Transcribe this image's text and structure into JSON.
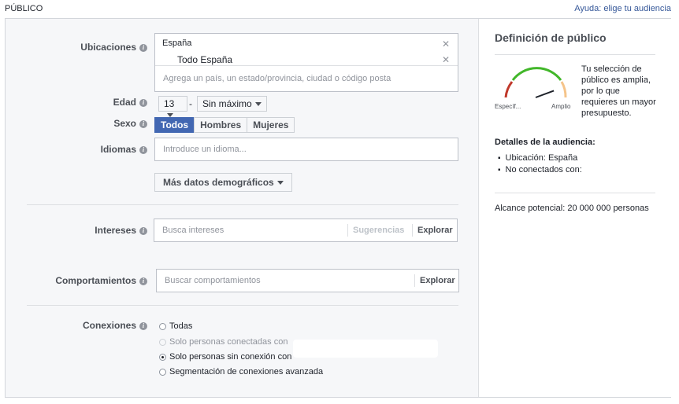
{
  "header": {
    "section_title": "PÚBLICO",
    "help_link": "Ayuda: elige tu audiencia"
  },
  "form": {
    "locations": {
      "label": "Ubicaciones",
      "country": "España",
      "region": "Todo España",
      "remove_icon": "close-icon",
      "input_placeholder": "Agrega un país, un estado/provincia, ciudad o código posta"
    },
    "age": {
      "label": "Edad",
      "min": "13",
      "separator": "-",
      "max": "Sin máximo"
    },
    "gender": {
      "label": "Sexo",
      "options": [
        "Todos",
        "Hombres",
        "Mujeres"
      ],
      "selected": "Todos"
    },
    "languages": {
      "label": "Idiomas",
      "placeholder": "Introduce un idioma..."
    },
    "more_demographics": "Más datos demográficos",
    "interests": {
      "label": "Intereses",
      "placeholder": "Busca intereses",
      "suggestions": "Sugerencias",
      "explore": "Explorar"
    },
    "behaviors": {
      "label": "Comportamientos",
      "placeholder": "Buscar comportamientos",
      "explore": "Explorar"
    },
    "connections": {
      "label": "Conexiones",
      "options": [
        {
          "label": "Todas",
          "state": "enabled"
        },
        {
          "label": "Solo personas conectadas con",
          "state": "disabled"
        },
        {
          "label": "Solo personas sin conexión con",
          "state": "checked"
        },
        {
          "label": "Segmentación de conexiones avanzada",
          "state": "enabled"
        }
      ]
    }
  },
  "audience": {
    "title": "Definición de público",
    "gauge": {
      "left_label": "Específ...",
      "right_label": "Amplio",
      "level": 0.78,
      "colors": {
        "red": "#c0392b",
        "green": "#42b72a",
        "orange": "#f5c48a",
        "needle": "#1d2129"
      }
    },
    "gauge_description": "Tu selección de público es amplia, por lo que requieres un mayor presupuesto.",
    "details_title": "Detalles de la audiencia:",
    "details": [
      "Ubicación: España",
      "No conectados con:"
    ],
    "reach": "Alcance potencial: 20 000 000 personas"
  },
  "colors": {
    "accent": "#4267b2",
    "link": "#365899",
    "panel_bg": "#f6f7f9"
  }
}
